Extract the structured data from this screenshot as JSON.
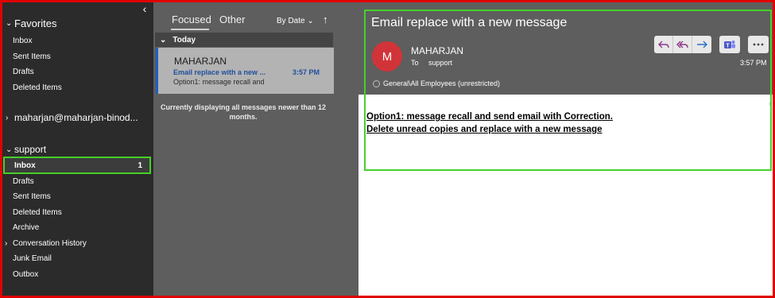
{
  "sidebar": {
    "collapse_glyph": "‹",
    "favorites": {
      "title": "Favorites",
      "items": [
        "Inbox",
        "Sent Items",
        "Drafts",
        "Deleted Items"
      ]
    },
    "account": {
      "title": "maharjan@maharjan-binod..."
    },
    "support": {
      "title": "support",
      "active_item": {
        "label": "Inbox",
        "count": "1"
      },
      "items": [
        "Drafts",
        "Sent Items",
        "Deleted Items",
        "Archive",
        "Conversation History",
        "Junk Email",
        "Outbox"
      ]
    }
  },
  "message_list": {
    "tabs": [
      "Focused",
      "Other"
    ],
    "active_tab": "Focused",
    "sort_label": "By Date",
    "group_label": "Today",
    "messages": [
      {
        "sender": "MAHARJAN",
        "subject": "Email replace with a new ...",
        "time": "3:57 PM",
        "preview": "Option1: message recall and"
      }
    ],
    "note": "Currently displaying all messages newer than 12 months."
  },
  "reader": {
    "subject": "Email replace with a new message",
    "avatar_initial": "M",
    "sender": "MAHARJAN",
    "to_label": "To",
    "recipient": "support",
    "time": "3:57 PM",
    "sensitivity": "General\\All Employees (unrestricted)",
    "body_lines": [
      "Option1: message recall and send email with Correction.",
      "Delete unread copies and replace with a new message"
    ]
  },
  "colors": {
    "highlight": "#45d12a",
    "frame": "#e00000",
    "avatar": "#d13438",
    "accent": "#1f4f9f"
  },
  "icons": [
    "reply-icon",
    "reply-all-icon",
    "forward-icon",
    "teams-icon",
    "more-icon",
    "chevron-down-icon",
    "chevron-right-icon",
    "sort-arrow-icon"
  ]
}
